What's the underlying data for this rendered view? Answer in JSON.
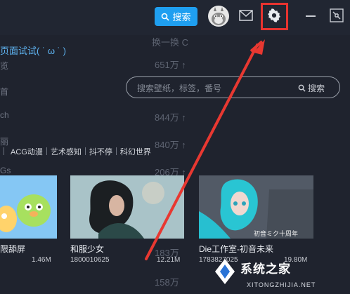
{
  "header": {
    "search_label": "搜索",
    "icons": {
      "search": "search-icon",
      "avatar": "avatar",
      "mail": "mail-icon",
      "settings": "gear-icon",
      "minimize": "minimize-icon",
      "restore": "restore-icon"
    }
  },
  "sidebar": {
    "title": "页面试试( ˙ ω ˙ )",
    "items": [
      "览",
      "首",
      "ch",
      "丽",
      "Gs"
    ]
  },
  "right_panel": {
    "line1": "换一换 C",
    "line2": "651万 ↑",
    "line3": "844万 ↑",
    "line4": "840万 ↑",
    "line5": "206万 ↑",
    "line6": "183万",
    "line7": "158万"
  },
  "search": {
    "placeholder": "搜索壁纸，标签，番号",
    "button": "搜索"
  },
  "tags": [
    "ACG动漫",
    "艺术感知",
    "抖不停",
    "科幻世界"
  ],
  "cards": [
    {
      "title": "限舔屏",
      "meta": "1.46M"
    },
    {
      "title": "和服少女",
      "meta_left": "1800010625",
      "meta_right": "12.21M"
    },
    {
      "title": "Die工作室-初音未来",
      "meta_left": "1783827025",
      "meta_right": "19.80M",
      "overlay": "初音ミク十周年"
    }
  ],
  "watermark": {
    "brand": "系统之家",
    "url": "XITONGZHIJIA.NET"
  }
}
